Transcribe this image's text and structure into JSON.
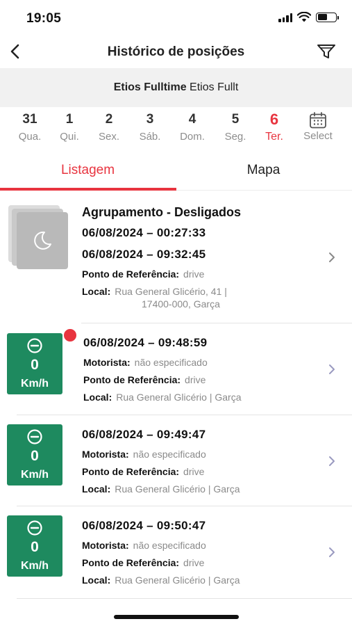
{
  "status": {
    "time": "19:05"
  },
  "header": {
    "title": "Histórico de posições"
  },
  "vehicle": {
    "name_bold": "Etios Fulltime",
    "name_extra": "Etios Fullt"
  },
  "days": [
    {
      "num": "31",
      "weekday": "Qua."
    },
    {
      "num": "1",
      "weekday": "Qui."
    },
    {
      "num": "2",
      "weekday": "Sex."
    },
    {
      "num": "3",
      "weekday": "Sáb."
    },
    {
      "num": "4",
      "weekday": "Dom."
    },
    {
      "num": "5",
      "weekday": "Seg."
    },
    {
      "num": "6",
      "weekday": "Ter."
    },
    {
      "num": "",
      "weekday": "Select"
    }
  ],
  "tabs": {
    "list": "Listagem",
    "map": "Mapa"
  },
  "group": {
    "title": "Agrupamento - Desligados",
    "start": "06/08/2024  –  00:27:33",
    "end": "06/08/2024  –  09:32:45",
    "ref_label": "Ponto de Referência:",
    "ref_value": "drive",
    "local_label": "Local:",
    "local_value": "Rua General Glicério, 41 |",
    "local_value2": "17400-000, Garça"
  },
  "positions": [
    {
      "datetime": "06/08/2024  –  09:48:59",
      "speed": "0",
      "unit": "Km/h",
      "driver_label": "Motorista:",
      "driver_value": "não especificado",
      "ref_label": "Ponto de Referência:",
      "ref_value": "drive",
      "local_label": "Local:",
      "local_value": "Rua General Glicério | Garça"
    },
    {
      "datetime": "06/08/2024  –  09:49:47",
      "speed": "0",
      "unit": "Km/h",
      "driver_label": "Motorista:",
      "driver_value": "não especificado",
      "ref_label": "Ponto de Referência:",
      "ref_value": "drive",
      "local_label": "Local:",
      "local_value": "Rua General Glicério | Garça"
    },
    {
      "datetime": "06/08/2024  –  09:50:47",
      "speed": "0",
      "unit": "Km/h",
      "driver_label": "Motorista:",
      "driver_value": "não especificado",
      "ref_label": "Ponto de Referência:",
      "ref_value": "drive",
      "local_label": "Local:",
      "local_value": "Rua General Glicério | Garça"
    }
  ],
  "colors": {
    "accent": "#e8343f",
    "speed_box": "#1e8a5f",
    "muted": "#8a8a8a"
  },
  "icons": [
    "back-arrow-icon",
    "filter-icon",
    "calendar-icon",
    "moon-icon",
    "minus-circle-icon",
    "chevron-right-icon"
  ]
}
